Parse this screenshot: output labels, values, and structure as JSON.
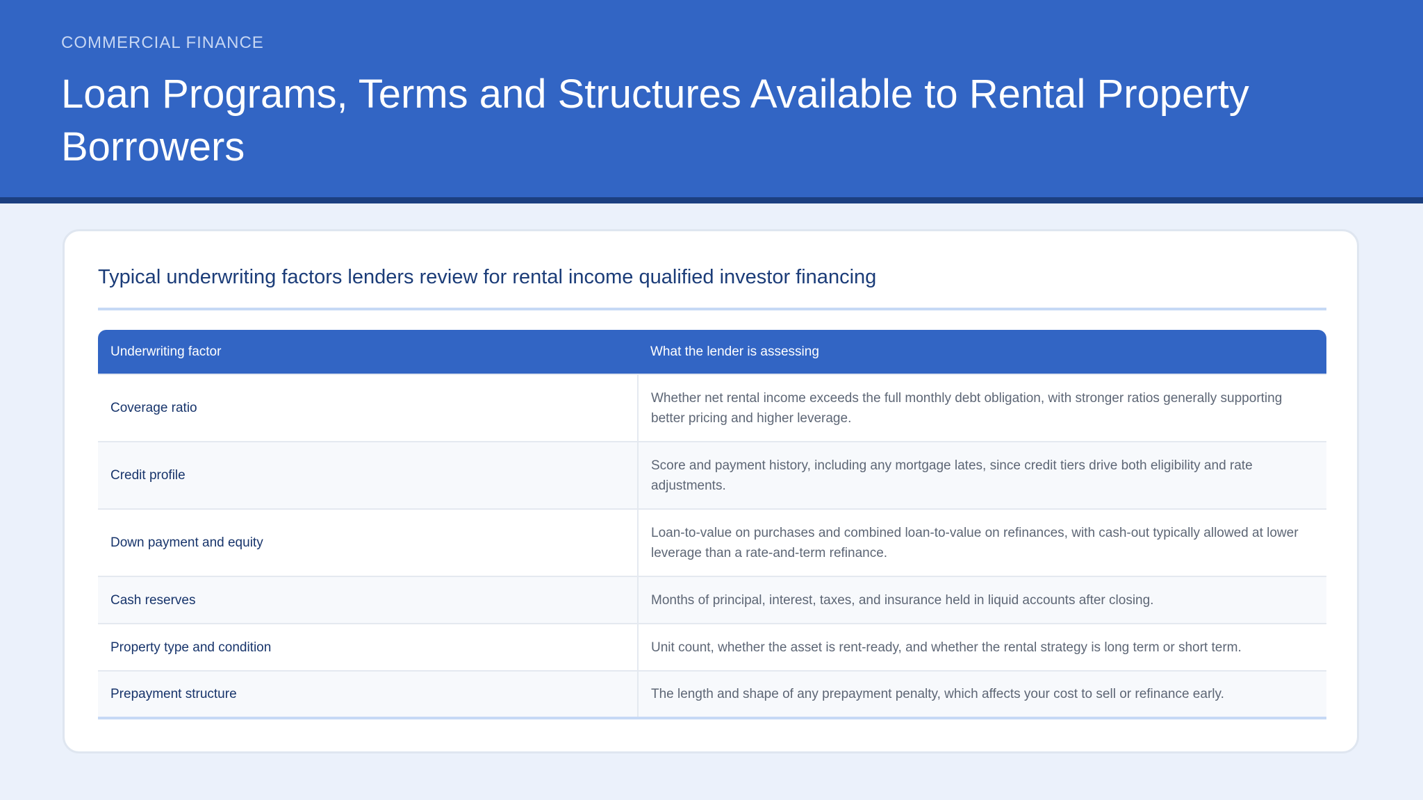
{
  "header": {
    "eyebrow": "COMMERCIAL FINANCE",
    "title": "Loan Programs, Terms and Structures Available to Rental Property Borrowers"
  },
  "card": {
    "title": "Typical underwriting factors lenders review for rental income qualified investor financing"
  },
  "table": {
    "headers": [
      "Underwriting factor",
      "What the lender is assessing"
    ],
    "rows": [
      {
        "factor": "Coverage ratio",
        "assessment": "Whether net rental income exceeds the full monthly debt obligation, with stronger ratios generally supporting better pricing and higher leverage."
      },
      {
        "factor": "Credit profile",
        "assessment": "Score and payment history, including any mortgage lates, since credit tiers drive both eligibility and rate adjustments."
      },
      {
        "factor": "Down payment and equity",
        "assessment": "Loan-to-value on purchases and combined loan-to-value on refinances, with cash-out typically allowed at lower leverage than a rate-and-term refinance."
      },
      {
        "factor": "Cash reserves",
        "assessment": "Months of principal, interest, taxes, and insurance held in liquid accounts after closing."
      },
      {
        "factor": "Property type and condition",
        "assessment": "Unit count, whether the asset is rent-ready, and whether the rental strategy is long term or short term."
      },
      {
        "factor": "Prepayment structure",
        "assessment": "The length and shape of any prepayment penalty, which affects your cost to sell or refinance early."
      }
    ]
  },
  "colors": {
    "header_bg": "#3265c4",
    "header_rule": "#1c3f80",
    "page_bg": "#ebf1fb",
    "title_text": "#1b3c78"
  }
}
